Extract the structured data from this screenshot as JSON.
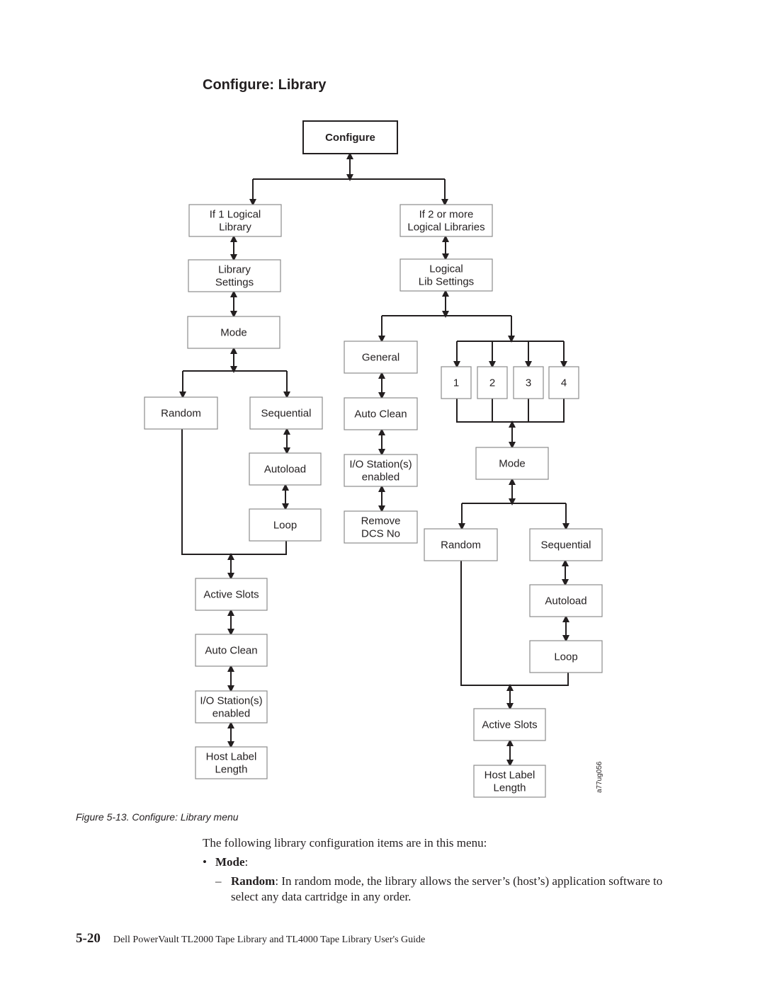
{
  "section_title": "Configure: Library",
  "diagram": {
    "figure_id": "a77ug056",
    "nodes": {
      "configure": [
        "Configure"
      ],
      "if1": [
        "If 1 Logical",
        "Library"
      ],
      "if2": [
        "If 2 or more",
        "Logical Libraries"
      ],
      "lib_settings": [
        "Library",
        "Settings"
      ],
      "logical_lib_settings": [
        "Logical",
        "Lib Settings"
      ],
      "mode_l": [
        "Mode"
      ],
      "random_l": [
        "Random"
      ],
      "sequential_l": [
        "Sequential"
      ],
      "autoload_l": [
        "Autoload"
      ],
      "loop_l": [
        "Loop"
      ],
      "active_slots_l": [
        "Active Slots"
      ],
      "auto_clean_l": [
        "Auto Clean"
      ],
      "io_station_l": [
        "I/O Station(s)",
        "enabled"
      ],
      "host_label_l": [
        "Host Label",
        "Length"
      ],
      "general": [
        "General"
      ],
      "auto_clean_g": [
        "Auto Clean"
      ],
      "io_station_g": [
        "I/O Station(s)",
        "enabled"
      ],
      "remove_dcs": [
        "Remove",
        "DCS No"
      ],
      "lib1": [
        "1"
      ],
      "lib2": [
        "2"
      ],
      "lib3": [
        "3"
      ],
      "lib4": [
        "4"
      ],
      "mode_r": [
        "Mode"
      ],
      "random_r": [
        "Random"
      ],
      "sequential_r": [
        "Sequential"
      ],
      "autoload_r": [
        "Autoload"
      ],
      "loop_r": [
        "Loop"
      ],
      "active_slots_r": [
        "Active Slots"
      ],
      "host_label_r": [
        "Host Label",
        "Length"
      ]
    }
  },
  "caption": "Figure 5-13. Configure: Library menu",
  "body": {
    "intro": "The following library configuration items are in this menu:",
    "bullet_mark": "•",
    "bullet_term": "Mode",
    "bullet_suffix": ":",
    "dash_mark": "–",
    "dash_term": "Random",
    "dash_text": ": In random mode, the library allows the server’s (host’s) application software to select any data cartridge in any order."
  },
  "footer": {
    "page_number": "5-20",
    "guide_title": "Dell PowerVault TL2000 Tape Library and TL4000 Tape Library User's Guide"
  }
}
